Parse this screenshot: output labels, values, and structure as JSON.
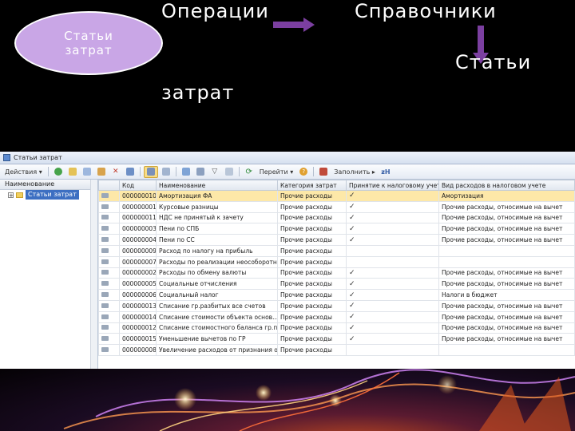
{
  "slide": {
    "bubble_label": "Статьи затрат",
    "step1": "Операции",
    "step2": "Справочники",
    "step3_part1": "Статьи",
    "step3_part2": "затрат",
    "arrow_color": "#7b3fa0"
  },
  "window": {
    "title": "Статьи затрат"
  },
  "toolbar": {
    "actions_label": "Действия ▾",
    "goto_label": "Перейти ▾",
    "fill_label": "Заполнить ▸"
  },
  "left_pane": {
    "header": "Наименование",
    "root_label": "Статьи затрат"
  },
  "grid": {
    "columns": [
      "Код",
      "Наименование",
      "Категория затрат",
      "Принятие к налоговому учету",
      "Вид расходов в налоговом учете"
    ],
    "rows": [
      {
        "code": "000000010",
        "name": "Амортизация ФА",
        "category": "Прочие расходы",
        "tax": "✓",
        "kind": "Амортизация"
      },
      {
        "code": "000000001",
        "name": "Курсовые разницы",
        "category": "Прочие расходы",
        "tax": "✓",
        "kind": "Прочие расходы, относимые на вычет"
      },
      {
        "code": "000000011",
        "name": "НДС не принятый к зачету",
        "category": "Прочие расходы",
        "tax": "✓",
        "kind": "Прочие расходы, относимые на вычет"
      },
      {
        "code": "000000003",
        "name": "Пени по СПБ",
        "category": "Прочие расходы",
        "tax": "✓",
        "kind": "Прочие расходы, относимые на вычет"
      },
      {
        "code": "000000004",
        "name": "Пени по СС",
        "category": "Прочие расходы",
        "tax": "✓",
        "kind": "Прочие расходы, относимые на вычет"
      },
      {
        "code": "000000009",
        "name": "Расход по налогу на прибыль",
        "category": "Прочие расходы",
        "tax": "",
        "kind": ""
      },
      {
        "code": "000000007",
        "name": "Расходы по реализации неособоротных",
        "category": "Прочие расходы",
        "tax": "",
        "kind": ""
      },
      {
        "code": "000000002",
        "name": "Расходы по обмену валюты",
        "category": "Прочие расходы",
        "tax": "✓",
        "kind": "Прочие расходы, относимые на вычет"
      },
      {
        "code": "000000005",
        "name": "Социальные отчисления",
        "category": "Прочие расходы",
        "tax": "✓",
        "kind": "Прочие расходы, относимые на вычет"
      },
      {
        "code": "000000006",
        "name": "Социальный налог",
        "category": "Прочие расходы",
        "tax": "✓",
        "kind": "Налоги в бюджет"
      },
      {
        "code": "000000013",
        "name": "Списание гр.разбитых все счетов",
        "category": "Прочие расходы",
        "tax": "✓",
        "kind": "Прочие расходы, относимые на вычет"
      },
      {
        "code": "000000014",
        "name": "Списание стоимости объекта основ...",
        "category": "Прочие расходы",
        "tax": "✓",
        "kind": "Прочие расходы, относимые на вычет"
      },
      {
        "code": "000000012",
        "name": "Списание стоимостного баланса гр.п...",
        "category": "Прочие расходы",
        "tax": "✓",
        "kind": "Прочие расходы, относимые на вычет"
      },
      {
        "code": "000000015",
        "name": "Уменьшение вычетов по ГР",
        "category": "Прочие расходы",
        "tax": "✓",
        "kind": "Прочие расходы, относимые на вычет"
      },
      {
        "code": "000000008",
        "name": "Увеличение расходов от признания ото...",
        "category": "Прочие расходы",
        "tax": "",
        "kind": ""
      }
    ]
  }
}
